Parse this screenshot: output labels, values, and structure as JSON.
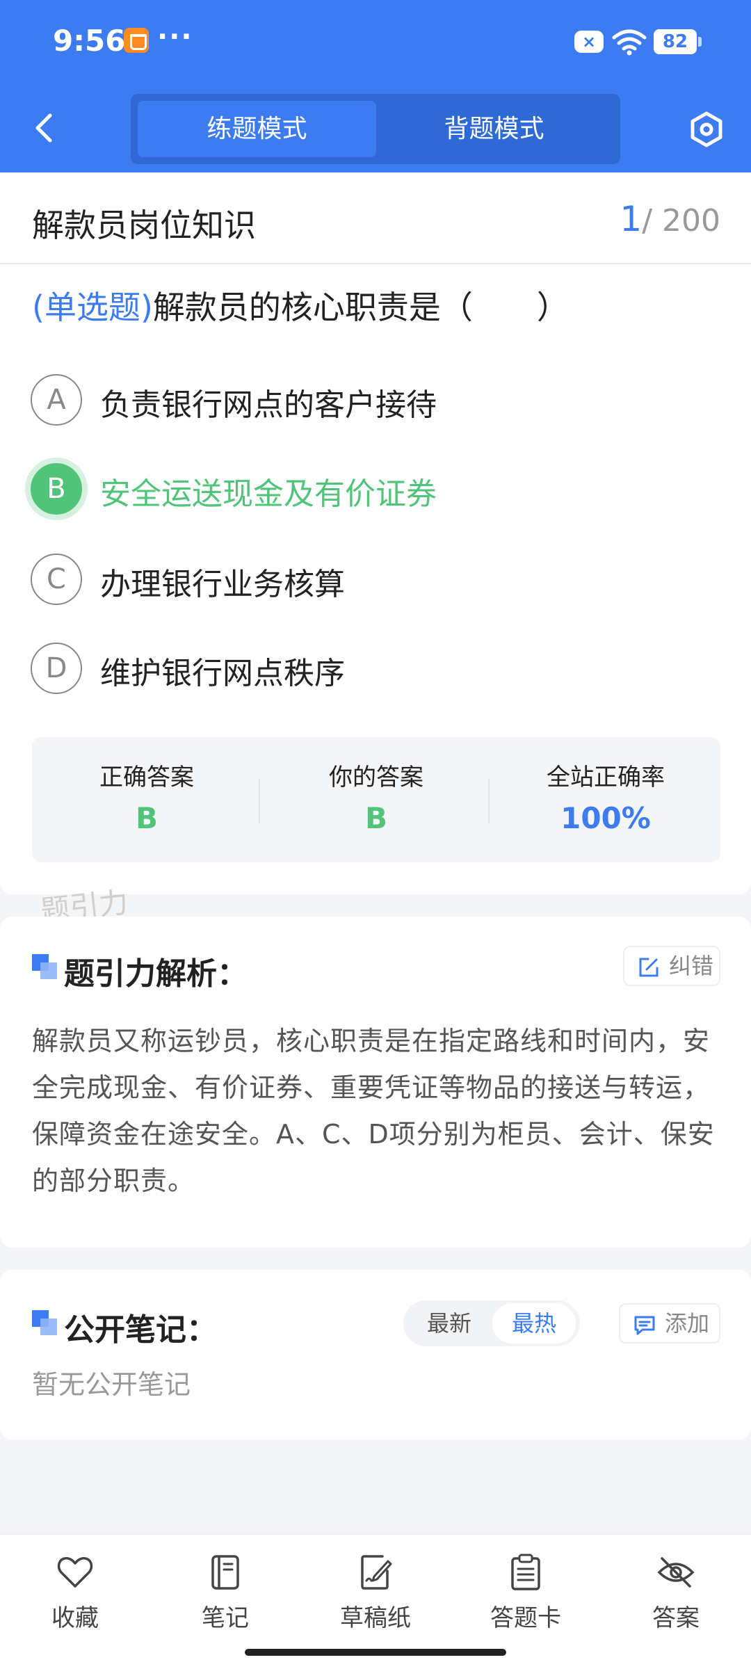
{
  "status_bar": {
    "time": "9:56",
    "dots": "···",
    "battery": "82",
    "x_badge": "×"
  },
  "header": {
    "tabs": [
      {
        "label": "练题模式",
        "active": true
      },
      {
        "label": "背题模式",
        "active": false
      }
    ]
  },
  "title_row": {
    "subject": "解款员岗位知识",
    "current": "1",
    "total": "/ 200"
  },
  "question": {
    "type": "(单选题)",
    "text": "解款员的核心职责是（　　）"
  },
  "options": [
    {
      "letter": "A",
      "text": "负责银行网点的客户接待",
      "state": "normal"
    },
    {
      "letter": "B",
      "text": "安全运送现金及有价证券",
      "state": "correct"
    },
    {
      "letter": "C",
      "text": "办理银行业务核算",
      "state": "normal"
    },
    {
      "letter": "D",
      "text": "维护银行网点秩序",
      "state": "normal"
    }
  ],
  "stats": [
    {
      "label": "正确答案",
      "value": "B",
      "color": "#52c47a"
    },
    {
      "label": "你的答案",
      "value": "B",
      "color": "#52c47a"
    },
    {
      "label": "全站正确率",
      "value": "100%",
      "color": "#3d7cf0"
    }
  ],
  "watermark": "题引力",
  "analysis": {
    "title": "题引力解析：",
    "report_label": "纠错",
    "text": "解款员又称运钞员，核心职责是在指定路线和时间内，安全完成现金、有价证券、重要凭证等物品的接送与转运，保障资金在途安全。A、C、D项分别为柜员、会计、保安的部分职责。"
  },
  "notes": {
    "title": "公开笔记：",
    "sort_options": [
      {
        "label": "最新",
        "active": false
      },
      {
        "label": "最热",
        "active": true
      }
    ],
    "add_label": "添加",
    "empty_text": "暂无公开笔记"
  },
  "bottom_nav": [
    {
      "label": "收藏",
      "icon": "heart-icon"
    },
    {
      "label": "笔记",
      "icon": "notebook-icon"
    },
    {
      "label": "草稿纸",
      "icon": "draft-paper-icon"
    },
    {
      "label": "答题卡",
      "icon": "answer-sheet-icon"
    },
    {
      "label": "答案",
      "icon": "eye-off-icon"
    }
  ],
  "colors": {
    "primary": "#3d7cf0",
    "correct": "#52c47a"
  }
}
